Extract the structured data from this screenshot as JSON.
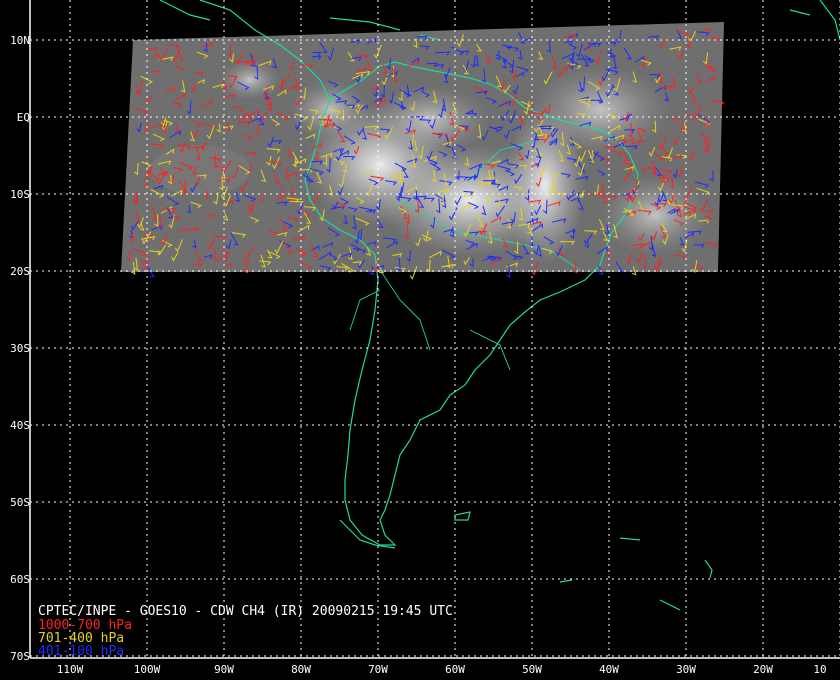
{
  "header_text": "CPTEC/INPE - GOES10 - CDW CH4 (IR) 20090215 19:45 UTC",
  "latitude_labels": [
    "10N",
    "EQ",
    "10S",
    "20S",
    "30S",
    "40S",
    "50S",
    "60S",
    "70S"
  ],
  "longitude_labels": [
    "110W",
    "100W",
    "90W",
    "80W",
    "70W",
    "60W",
    "50W",
    "40W",
    "30W",
    "20W",
    "10"
  ],
  "legend": [
    {
      "label": "1000-700 hPa",
      "color": "#ff2020"
    },
    {
      "label": "701-400 hPa",
      "color": "#e6d21e"
    },
    {
      "label": "401-100 hPa",
      "color": "#1c2cff"
    }
  ],
  "colors": {
    "background": "#000000",
    "coastline": "#20d8a0",
    "grid": "#ffffff",
    "satellite_panel": "#7a7a7a"
  },
  "icons": {
    "wind_vector": "barb-icon"
  }
}
